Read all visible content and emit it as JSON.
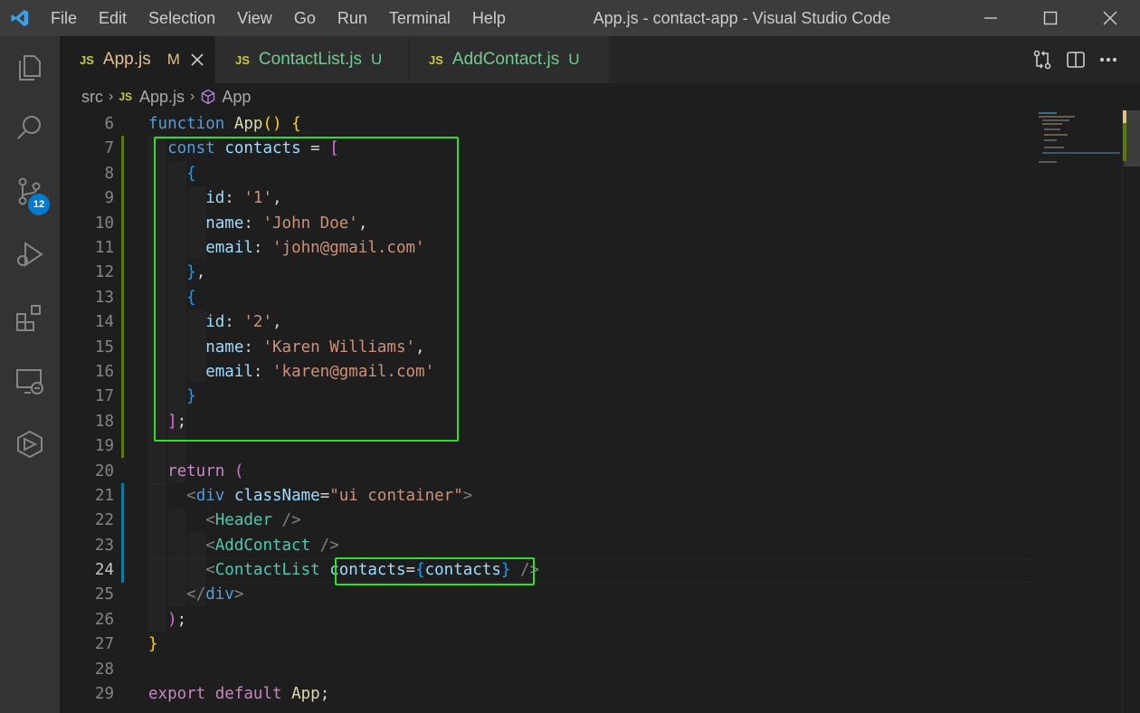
{
  "window": {
    "title": "App.js - contact-app - Visual Studio Code",
    "menu": [
      "File",
      "Edit",
      "Selection",
      "View",
      "Go",
      "Run",
      "Terminal",
      "Help"
    ]
  },
  "activity_bar": {
    "items": [
      "explorer-icon",
      "search-icon",
      "source-control-icon",
      "run-debug-icon",
      "extensions-icon",
      "remote-explorer-icon",
      "docker-icon"
    ],
    "source_control_badge": "12"
  },
  "tabs": [
    {
      "icon": "JS",
      "label": "App.js",
      "status": "M",
      "active": true
    },
    {
      "icon": "JS",
      "label": "ContactList.js",
      "status": "U",
      "active": false
    },
    {
      "icon": "JS",
      "label": "AddContact.js",
      "status": "U",
      "active": false
    }
  ],
  "breadcrumb": {
    "folder": "src",
    "file_icon": "JS",
    "file": "App.js",
    "symbol": "App"
  },
  "editor": {
    "current_line": 24,
    "lines": [
      6,
      7,
      8,
      9,
      10,
      11,
      12,
      13,
      14,
      15,
      16,
      17,
      18,
      19,
      20,
      21,
      22,
      23,
      24,
      25,
      26,
      27,
      28,
      29
    ]
  },
  "colors": {
    "accent": "#007acc",
    "highlight": "#2ee02e",
    "modified": "#e2c08d",
    "untracked": "#73c991"
  }
}
